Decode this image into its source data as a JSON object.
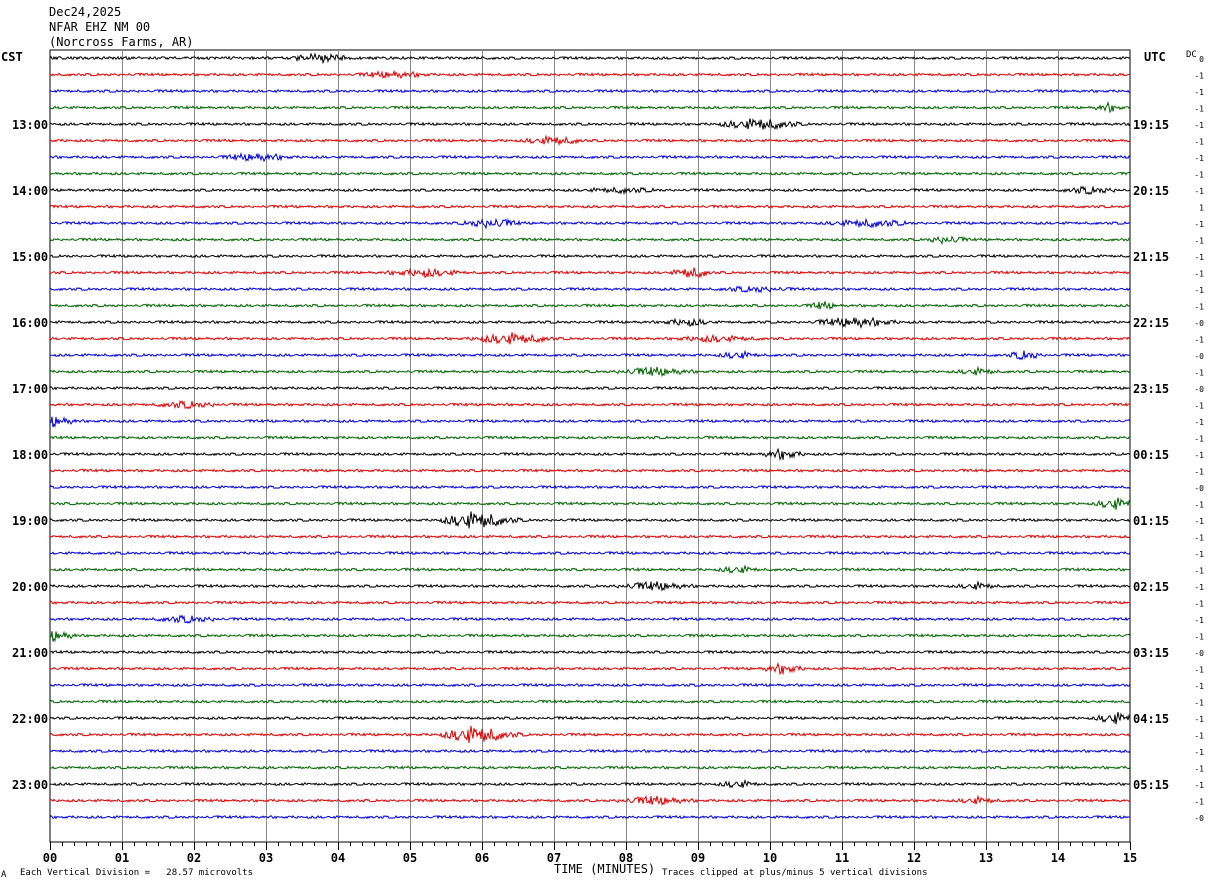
{
  "header": {
    "date": "Dec24,2025",
    "station": "NFAR EHZ NM 00",
    "location": "(Norcross Farms, AR)"
  },
  "left_zone_label": "CST",
  "right_zone_label": "UTC",
  "dc_label": "DC",
  "footer": {
    "scale_note": "Each Vertical Division =   28.57 microvolts",
    "x_title": "TIME (MINUTES)",
    "clip_note": "Traces clipped at plus/minus 5 vertical divisions",
    "corner_mark": "A"
  },
  "chart_data": {
    "type": "line",
    "subtype": "helicorder",
    "xlabel": "TIME (MINUTES)",
    "xlim": [
      0,
      15
    ],
    "x_ticks": [
      "00",
      "01",
      "02",
      "03",
      "04",
      "05",
      "06",
      "07",
      "08",
      "09",
      "10",
      "11",
      "12",
      "13",
      "14",
      "15"
    ],
    "colors": [
      "#000000",
      "#e00000",
      "#0000e0",
      "#006400"
    ],
    "grid": true,
    "trace_count": 47,
    "left_time_labels": [
      "13:00",
      "14:00",
      "15:00",
      "16:00",
      "17:00",
      "18:00",
      "19:00",
      "20:00",
      "21:00",
      "22:00",
      "23:00"
    ],
    "right_time_labels": [
      "19:15",
      "20:15",
      "21:15",
      "22:15",
      "23:15",
      "00:15",
      "01:15",
      "02:15",
      "03:15",
      "04:15",
      "05:15"
    ],
    "label_first_trace_index": 4,
    "label_trace_step": 4,
    "dc_offsets": [
      "0",
      "-1",
      "-1",
      "-1",
      "-1",
      "-1",
      "-1",
      "-1",
      "-1",
      "1",
      "-1",
      "-1",
      "-1",
      "-1",
      "-1",
      "-1",
      "-0",
      "-1",
      "-0",
      "-1",
      "-0",
      "-1",
      "-1",
      "-1",
      "-1",
      "-1",
      "-0",
      "-1",
      "-1",
      "-1",
      "-1",
      "-1",
      "-1",
      "-1",
      "-1",
      "-1",
      "-0",
      "-1",
      "-1",
      "-1",
      "-1",
      "-1",
      "-1",
      "-1",
      "-1",
      "-1",
      "-0"
    ]
  }
}
